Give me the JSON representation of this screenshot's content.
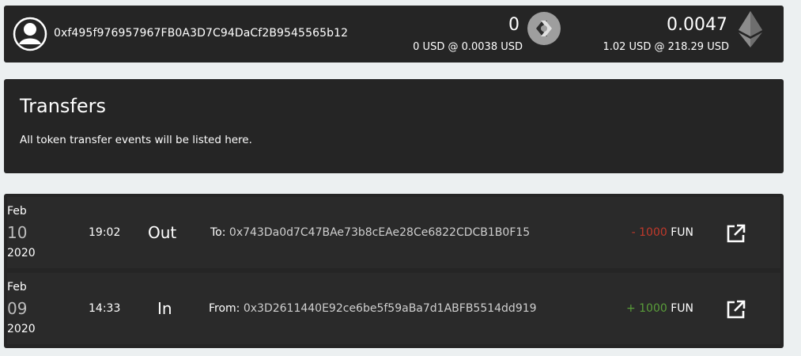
{
  "account": {
    "address": "0xf495f976957967FB0A3D7C94DaCf2B9545565b12"
  },
  "balances": {
    "fun": {
      "amount": "0",
      "usd": "0 USD @ 0.0038 USD",
      "icon": "funfair-icon"
    },
    "eth": {
      "amount": "0.0047",
      "usd": "1.02 USD @ 218.29 USD",
      "icon": "ethereum-icon"
    }
  },
  "info": {
    "title": "Transfers",
    "description": "All token transfer events will be listed here."
  },
  "transfers": [
    {
      "month": "Feb",
      "day": "10",
      "year": "2020",
      "time": "19:02",
      "direction": "Out",
      "party_label": "To:",
      "party_address": "0x743Da0d7C47BAe73b8cEAe28Ce6822CDCB1B0F15",
      "amount": "- 1000",
      "token": "FUN"
    },
    {
      "month": "Feb",
      "day": "09",
      "year": "2020",
      "time": "14:33",
      "direction": "In",
      "party_label": "From:",
      "party_address": "0x3D2611440E92ce6be5f59aBa7d1ABFB5514dd919",
      "amount": "+ 1000",
      "token": "FUN"
    }
  ],
  "colors": {
    "panel": "#252525",
    "background": "#ecf0f1",
    "out": "#c0392b",
    "in": "#5a9e3a"
  }
}
